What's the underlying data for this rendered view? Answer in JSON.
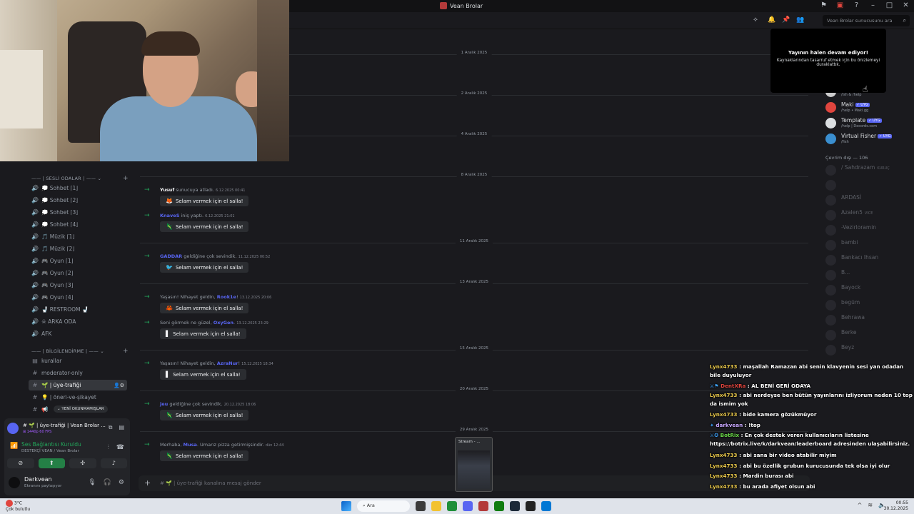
{
  "window": {
    "title": "Vean Brolar"
  },
  "header": {
    "search_placeholder": "Vean Brolar sunucusunu ara"
  },
  "sidebar": {
    "voice_category": "SESLİ ODALAR",
    "voice_channels": [
      {
        "glyph": "🔊",
        "label": "💭 Sohbet ⌈1⌋"
      },
      {
        "glyph": "🔊",
        "label": "💭 Sohbet ⌈2⌋"
      },
      {
        "glyph": "🔊",
        "label": "💭 Sohbet ⌈3⌋"
      },
      {
        "glyph": "🔊",
        "label": "💭 Sohbet ⌈4⌋"
      },
      {
        "glyph": "🔊",
        "label": "🎵 Müzik ⌈1⌋"
      },
      {
        "glyph": "🔊",
        "label": "🎵 Müzik ⌈2⌋"
      },
      {
        "glyph": "🔊",
        "label": "🎮 Oyun ⌈1⌋"
      },
      {
        "glyph": "🔊",
        "label": "🎮 Oyun ⌈2⌋"
      },
      {
        "glyph": "🔊",
        "label": "🎮 Oyun ⌈3⌋"
      },
      {
        "glyph": "🔊",
        "label": "🎮 Oyun ⌈4⌋"
      },
      {
        "glyph": "🔊",
        "label": "🚽 RESTROOM 🚽"
      },
      {
        "glyph": "🔊",
        "label": "☠ ARKA ODA"
      },
      {
        "glyph": "🔊",
        "label": "AFK"
      }
    ],
    "info_category": "BİLGİLENDİRME",
    "text_channels": [
      {
        "glyph": "▤",
        "label": "kurallar"
      },
      {
        "glyph": "#",
        "label": "moderator-only"
      },
      {
        "glyph": "#",
        "label": "🌱 | üye-trafiği",
        "active": true
      },
      {
        "glyph": "#",
        "label": "💡 | öneri-ve-şikayet"
      },
      {
        "glyph": "#",
        "label": "📢"
      }
    ],
    "unread_pill": "YENİ OKUNMAMIŞLAR"
  },
  "now_playing": {
    "title": "# 🌱 | üye-trafiği | Vean Brolar ...",
    "sub": "⊞ 1440p 60 FPS"
  },
  "voice": {
    "title": "Ses Bağlantısı Kuruldu",
    "sub": "DESTEKÇİ VEAN / Vean Brolar"
  },
  "user": {
    "name": "Darkvean",
    "status": "Ekranını paylaşıyor"
  },
  "messages": {
    "wave_label": "Selam vermek için el salla!",
    "dates": [
      "1 Aralık 2025",
      "2 Aralık 2025",
      "4 Aralık 2025",
      "8 Aralık 2025",
      "11 Aralık 2025",
      "13 Aralık 2025",
      "15 Aralık 2025",
      "20 Aralık 2025",
      "29 Aralık 2025"
    ],
    "items": [
      {
        "pre": "",
        "name": "Yusuf",
        "post": " sunucuya atladı.",
        "time": "6.12.2025 00:41",
        "sticker": "🦊"
      },
      {
        "pre": "",
        "name": "KnaveS",
        "post": " iniş yaptı.",
        "time": "6.12.2025 21:01",
        "sticker": "🦎"
      },
      {
        "pre": "",
        "name": "GADDAR",
        "post": " geldiğine çok sevindik.",
        "time": "11.12.2025 00:52",
        "sticker": "🐦"
      },
      {
        "pre": "Yaşasın! Nihayet geldin, ",
        "name": "Rook1e",
        "post": "!",
        "time": "13.12.2025 20:06",
        "sticker": "🦀"
      },
      {
        "pre": "Seni görmek ne güzel, ",
        "name": "OxyGen",
        "post": ".",
        "time": "13.12.2025 23:29",
        "sticker": "▌"
      },
      {
        "pre": "Yaşasın! Nihayet geldin, ",
        "name": "AzraNur",
        "post": "!",
        "time": "15.12.2025 18:34",
        "sticker": "▌"
      },
      {
        "pre": "",
        "name": "jeu",
        "post": " geldiğine çok sevindik.",
        "time": "20.12.2025 18:06",
        "sticker": "🦎"
      },
      {
        "pre": "Merhaba, ",
        "name": "Musa",
        "post": ". Umarız pizza getirmişsindir.",
        "time": "dün 12:44",
        "sticker": "🦎"
      }
    ]
  },
  "composer": {
    "placeholder": "# 🌱 | üye-trafiği kanalına mesaj gönder"
  },
  "notice": {
    "title": "Yayının halen devam ediyor!",
    "sub": "Kaynaklarından tasarruf etmek için bu önizlemeyi duraklattık."
  },
  "members": {
    "online": [
      {
        "name": "",
        "sub": "/ish & /help",
        "color": "#ccc"
      },
      {
        "name": "Maki",
        "badge": "✓ UYG",
        "sub": "/help • Maki.gg",
        "color": "#e0453e"
      },
      {
        "name": "Template",
        "badge": "✓ UYG",
        "sub": "/help | Docords.com",
        "color": "#dbdee1"
      },
      {
        "name": "Virtual Fisher",
        "badge": "✓ UYG",
        "sub": "/fish",
        "color": "#3a8fd0"
      }
    ],
    "offline_header": "Çevrim dışı — 106",
    "offline": [
      {
        "name": "/ Sahdrazam",
        "tag": "KURUÇ"
      },
      {
        "name": ""
      },
      {
        "name": "ARDASİ"
      },
      {
        "name": "Azalen5",
        "tag": "VICE"
      },
      {
        "name": "-Vezirloramin"
      },
      {
        "name": "bambi"
      },
      {
        "name": "Bankacı Ihsan"
      },
      {
        "name": "B..."
      },
      {
        "name": "Bayock"
      },
      {
        "name": "begüm"
      },
      {
        "name": "Behrawa"
      },
      {
        "name": "Berke"
      },
      {
        "name": "Beyz"
      }
    ]
  },
  "stream_chat": [
    {
      "user": "Lynx4733",
      "cls": "u-yel",
      "text": ": maşallah Ramazan abi senin klavyenin sesi yan odadan bile duyuluyor"
    },
    {
      "user": "DentXRa",
      "cls": "u-red",
      "icons": "⚔⚑",
      "text": ": AL BENİ GERİ ODAYA"
    },
    {
      "user": "Lynx4733",
      "cls": "u-yel",
      "text": ": abi nerdeyse ben bütün yayınlarını izliyorum neden 10 top da ismim yok"
    },
    {
      "user": "Lynx4733",
      "cls": "u-yel",
      "text": ": bide kamera gözükmüyor"
    },
    {
      "user": "darkvean",
      "cls": "u-pur",
      "icons": "✦",
      "text": ": !top"
    },
    {
      "user": "BotRix",
      "cls": "u-grn",
      "icons": "⚔✪",
      "text": ": En çok destek veren kullanıcıların listesine https://botrix.live/k/darkvean/leaderboard adresinden ulaşabilirsiniz."
    },
    {
      "user": "Lynx4733",
      "cls": "u-yel",
      "text": ": abi sana bir video atabilir miyim"
    },
    {
      "user": "Lynx4733",
      "cls": "u-yel",
      "text": ": abi bu özellik grubun kurucusunda tek olsa iyi olur"
    },
    {
      "user": "Lynx4733",
      "cls": "u-yel",
      "text": ": Mardin burası abi"
    },
    {
      "user": "Lynx4733",
      "cls": "u-yel",
      "text": ": bu arada afiyet olsun abi"
    }
  ],
  "thumb": {
    "label": "Stream - ..."
  },
  "taskbar": {
    "search": "Ara",
    "weather_temp": "3°C",
    "weather_text": "Çok bulutlu",
    "time": "00:55",
    "date": "30.12.2025"
  }
}
